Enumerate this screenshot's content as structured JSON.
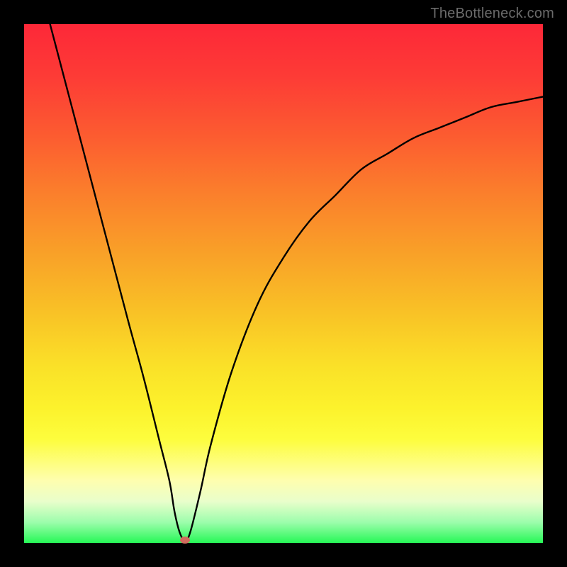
{
  "watermark": "TheBottleneck.com",
  "chart_data": {
    "type": "line",
    "title": "",
    "xlabel": "",
    "ylabel": "",
    "xlim": [
      0,
      100
    ],
    "ylim": [
      0,
      100
    ],
    "grid": false,
    "gradient_stops": [
      {
        "pos": 0,
        "color": "#fd2838"
      },
      {
        "pos": 10,
        "color": "#fd3b36"
      },
      {
        "pos": 22,
        "color": "#fc5d30"
      },
      {
        "pos": 32,
        "color": "#fb7d2c"
      },
      {
        "pos": 44,
        "color": "#f9a028"
      },
      {
        "pos": 56,
        "color": "#f9c326"
      },
      {
        "pos": 66,
        "color": "#fae128"
      },
      {
        "pos": 74,
        "color": "#fcf22c"
      },
      {
        "pos": 80,
        "color": "#fdfd3d"
      },
      {
        "pos": 88,
        "color": "#fefeaf"
      },
      {
        "pos": 92,
        "color": "#e9fecb"
      },
      {
        "pos": 96,
        "color": "#9dfdac"
      },
      {
        "pos": 100,
        "color": "#27f857"
      }
    ],
    "series": [
      {
        "name": "bottleneck-curve",
        "x": [
          5,
          10,
          15,
          20,
          23,
          26,
          28,
          29,
          30,
          31,
          32,
          34,
          36,
          40,
          45,
          50,
          55,
          60,
          65,
          70,
          75,
          80,
          85,
          90,
          95,
          100
        ],
        "y": [
          100,
          81,
          62,
          43,
          32,
          20,
          12,
          6,
          2,
          0.5,
          2,
          10,
          19,
          33,
          46,
          55,
          62,
          67,
          72,
          75,
          78,
          80,
          82,
          84,
          85,
          86
        ]
      }
    ],
    "min_point": {
      "x": 31,
      "y": 0.5,
      "color": "#d26b5e"
    }
  }
}
